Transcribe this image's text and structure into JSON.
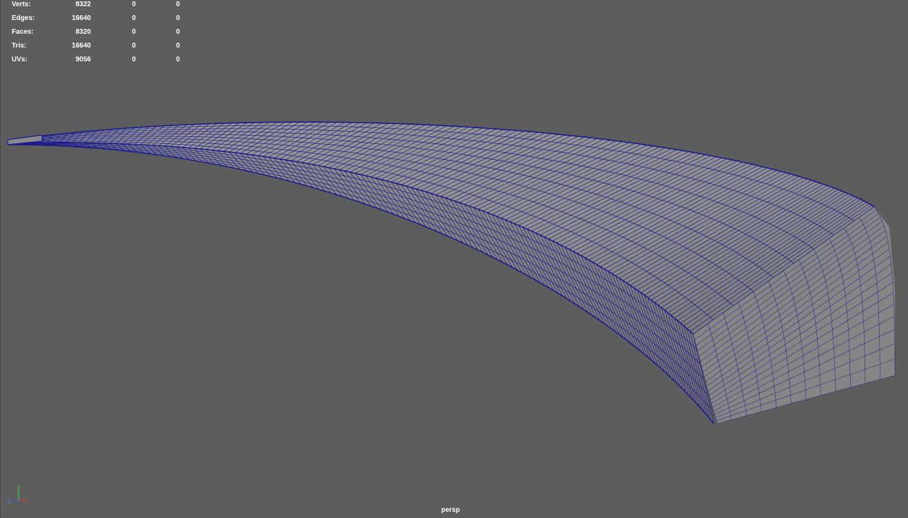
{
  "heads_up_display": {
    "rows": [
      {
        "label": "Verts:",
        "values": [
          "8322",
          "0",
          "0"
        ]
      },
      {
        "label": "Edges:",
        "values": [
          "16640",
          "0",
          "0"
        ]
      },
      {
        "label": "Faces:",
        "values": [
          "8320",
          "0",
          "0"
        ]
      },
      {
        "label": "Tris:",
        "values": [
          "16640",
          "0",
          "0"
        ]
      },
      {
        "label": "UVs:",
        "values": [
          "9056",
          "0",
          "0"
        ]
      }
    ]
  },
  "viewport": {
    "camera_name": "persp",
    "background_color": "#5d5d5d",
    "wireframe_color": "#1a1a8c",
    "shaded_color": "#8f8f8f"
  },
  "axis_gizmo": {
    "y_label": "y",
    "z_label": "z",
    "x_label": "x"
  }
}
